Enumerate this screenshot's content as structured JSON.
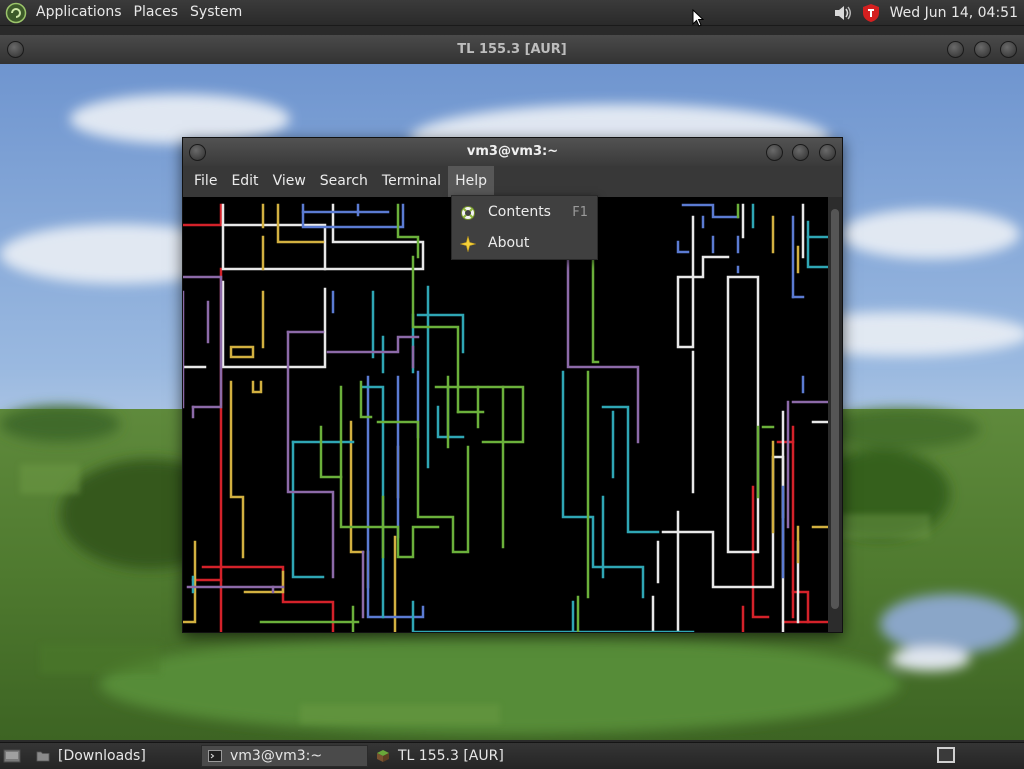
{
  "top_panel": {
    "menus": [
      "Applications",
      "Places",
      "System"
    ],
    "clock": "Wed Jun 14, 04:51"
  },
  "tl_window": {
    "title": "TL 155.3 [AUR]"
  },
  "terminal": {
    "title": "vm3@vm3:~",
    "menu": [
      "File",
      "Edit",
      "View",
      "Search",
      "Terminal",
      "Help"
    ],
    "active_menu": "Help"
  },
  "help_menu": {
    "items": [
      {
        "label": "Contents",
        "accel": "F1",
        "icon": "help-contents-icon"
      },
      {
        "label": "About",
        "accel": "",
        "icon": "about-star-icon"
      }
    ]
  },
  "taskbar": {
    "tasks": [
      {
        "label": "[Downloads]",
        "icon": "folder-icon"
      },
      {
        "label": "vm3@vm3:~",
        "icon": "terminal-icon"
      },
      {
        "label": "TL 155.3 [AUR]",
        "icon": "grass-block-icon"
      }
    ]
  },
  "pipes_colors": {
    "red": "#d4222a",
    "white": "#e8e8e8",
    "yellow": "#d2b040",
    "blue": "#5b7bd2",
    "cyan": "#2fa6b4",
    "green": "#6bb03b",
    "purple": "#8c6aa8"
  }
}
